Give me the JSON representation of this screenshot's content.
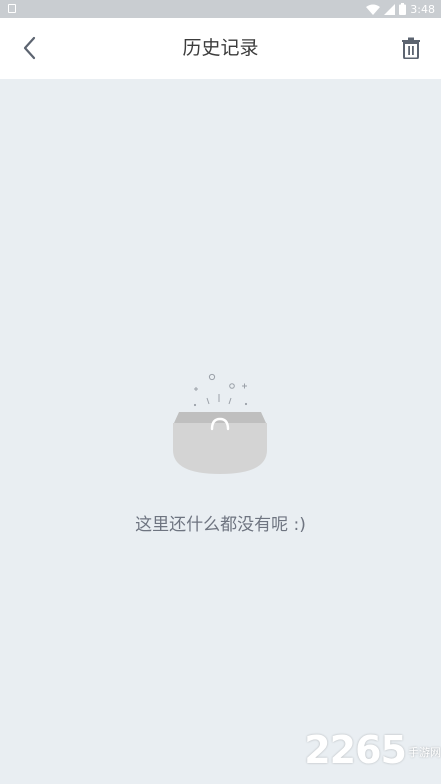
{
  "status_bar": {
    "time": "3:48",
    "icons": [
      "notification-icon",
      "wifi-icon",
      "signal-icon",
      "battery-icon"
    ]
  },
  "header": {
    "title": "历史记录",
    "back_icon": "chevron-left-icon",
    "delete_icon": "trash-icon"
  },
  "empty_state": {
    "message": "这里还什么都没有呢 :)",
    "illustration": "empty-bag-icon"
  },
  "watermark": {
    "number": "2265",
    "suffix": "手游网"
  },
  "colors": {
    "background": "#e9eef2",
    "header_bg": "#ffffff",
    "title": "#3c3c3c",
    "empty_text": "#6e7480",
    "icon": "#5c6470"
  }
}
